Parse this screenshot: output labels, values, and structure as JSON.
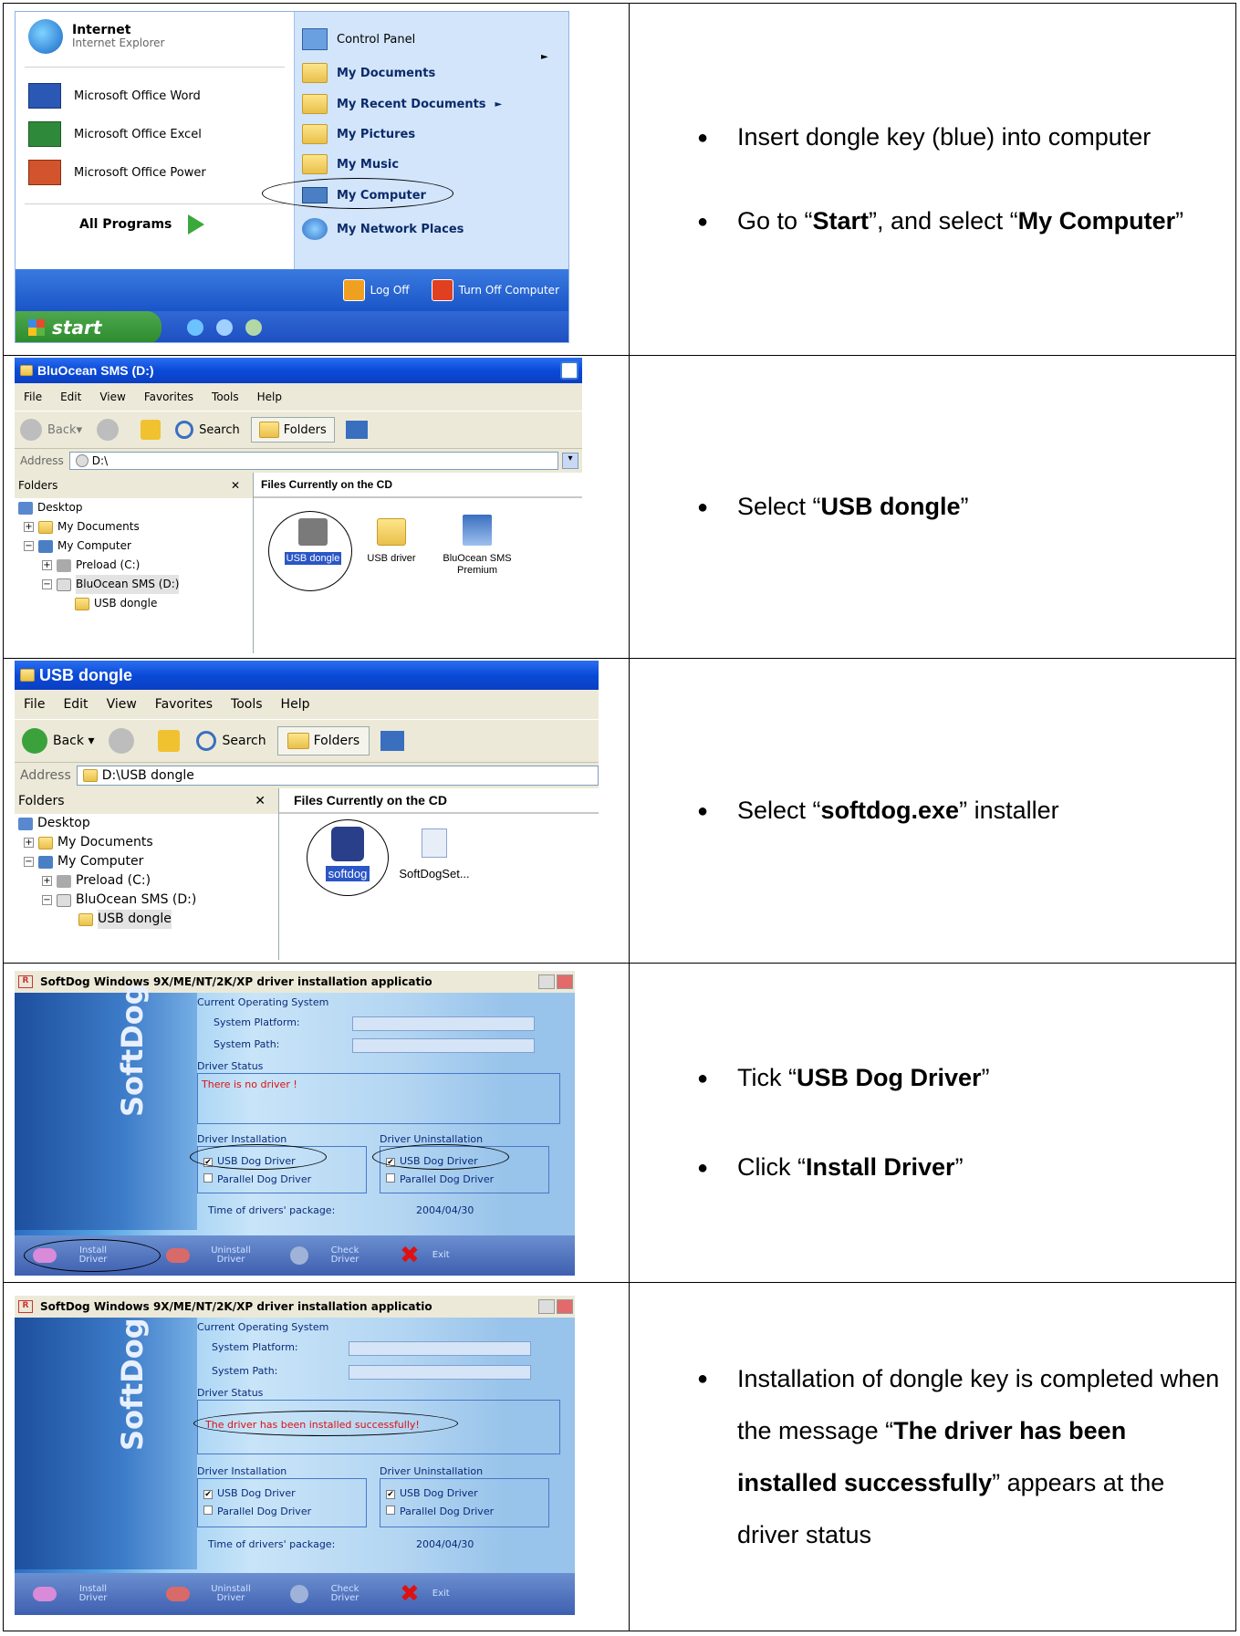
{
  "rows": [
    {
      "bullets": [
        {
          "pre": "Insert dongle key (blue) into computer",
          "b1": "",
          "mid": "",
          "b2": "",
          "post": ""
        },
        {
          "pre": "Go to “",
          "b1": "Start",
          "mid": "”, and select “",
          "b2": "My Computer",
          "post": "”"
        }
      ]
    },
    {
      "bullets": [
        {
          "pre": "Select “",
          "b1": "USB dongle",
          "mid": "”",
          "b2": "",
          "post": ""
        }
      ]
    },
    {
      "bullets": [
        {
          "pre": "Select “",
          "b1": "softdog.exe",
          "mid": "” installer",
          "b2": "",
          "post": ""
        }
      ]
    },
    {
      "bullets": [
        {
          "pre": "Tick “",
          "b1": "USB Dog Driver",
          "mid": "”",
          "b2": "",
          "post": ""
        },
        {
          "pre": "Click “",
          "b1": "Install Driver",
          "mid": "”",
          "b2": "",
          "post": ""
        }
      ]
    },
    {
      "bullets": [
        {
          "pre": "Installation of dongle key is completed when the message “",
          "b1": "The driver has been installed successfully",
          "mid": "” appears at the driver status",
          "b2": "",
          "post": ""
        }
      ]
    }
  ],
  "start_menu": {
    "left_items": [
      {
        "title": "Internet",
        "sub": "Internet Explorer"
      },
      {
        "title": "Microsoft Office Word",
        "sub": ""
      },
      {
        "title": "Microsoft Office Excel",
        "sub": ""
      },
      {
        "title": "Microsoft Office Power",
        "sub": ""
      }
    ],
    "all_programs": "All Programs",
    "right_items": [
      "Control Panel",
      "My Documents",
      "My Recent Documents",
      "My Pictures",
      "My Music",
      "My Computer",
      "My Network Places"
    ],
    "log_off": "Log Off",
    "turn_off": "Turn Off Computer",
    "start": "start"
  },
  "explorer1": {
    "title": "BluOcean SMS (D:)",
    "menu": [
      "File",
      "Edit",
      "View",
      "Favorites",
      "Tools",
      "Help"
    ],
    "back": "Back",
    "search": "Search",
    "folders": "Folders",
    "address_label": "Address",
    "address": "D:\\",
    "folders_pane": "Folders",
    "files_header": "Files Currently on the CD",
    "tree": [
      "Desktop",
      "My Documents",
      "My Computer",
      "Preload (C:)",
      "BluOcean SMS (D:)",
      "USB dongle"
    ],
    "files": [
      "USB dongle",
      "USB driver",
      "BluOcean SMS Premium"
    ]
  },
  "explorer2": {
    "title": "USB dongle",
    "menu": [
      "File",
      "Edit",
      "View",
      "Favorites",
      "Tools",
      "Help"
    ],
    "back": "Back",
    "search": "Search",
    "folders": "Folders",
    "address_label": "Address",
    "address": "D:\\USB dongle",
    "folders_pane": "Folders",
    "files_header": "Files Currently on the CD",
    "tree": [
      "Desktop",
      "My Documents",
      "My Computer",
      "Preload (C:)",
      "BluOcean SMS (D:)",
      "USB dongle"
    ],
    "files": [
      "softdog",
      "SoftDogSet..."
    ]
  },
  "softdog1": {
    "title": "SoftDog Windows 9X/ME/NT/2K/XP  driver installation applicatio",
    "current_os": "Current Operating System",
    "system_platform": "System Platform:",
    "system_path": "System Path:",
    "driver_status": "Driver Status",
    "status_msg": "There is no  driver !",
    "driver_installation": "Driver Installation",
    "driver_uninstallation": "Driver Uninstallation",
    "usb_dog": "USB Dog Driver",
    "parallel_dog": "Parallel Dog Driver",
    "time_label": "Time of drivers' package:",
    "time_value": "2004/04/30",
    "brand": "SoftDog",
    "btn_install": "Install Driver",
    "btn_uninstall": "Uninstall Driver",
    "btn_check": "Check Driver",
    "btn_exit": "Exit"
  },
  "softdog2": {
    "title": "SoftDog Windows 9X/ME/NT/2K/XP  driver installation applicatio",
    "current_os": "Current Operating System",
    "system_platform": "System Platform:",
    "system_path": "System Path:",
    "driver_status": "Driver Status",
    "status_msg": "The driver has been installed successfully!",
    "driver_installation": "Driver Installation",
    "driver_uninstallation": "Driver Uninstallation",
    "usb_dog": "USB Dog Driver",
    "parallel_dog": "Parallel Dog Driver",
    "time_label": "Time of drivers' package:",
    "time_value": "2004/04/30",
    "brand": "SoftDog",
    "btn_install": "Install Driver",
    "btn_uninstall": "Uninstall Driver",
    "btn_check": "Check Driver",
    "btn_exit": "Exit"
  }
}
